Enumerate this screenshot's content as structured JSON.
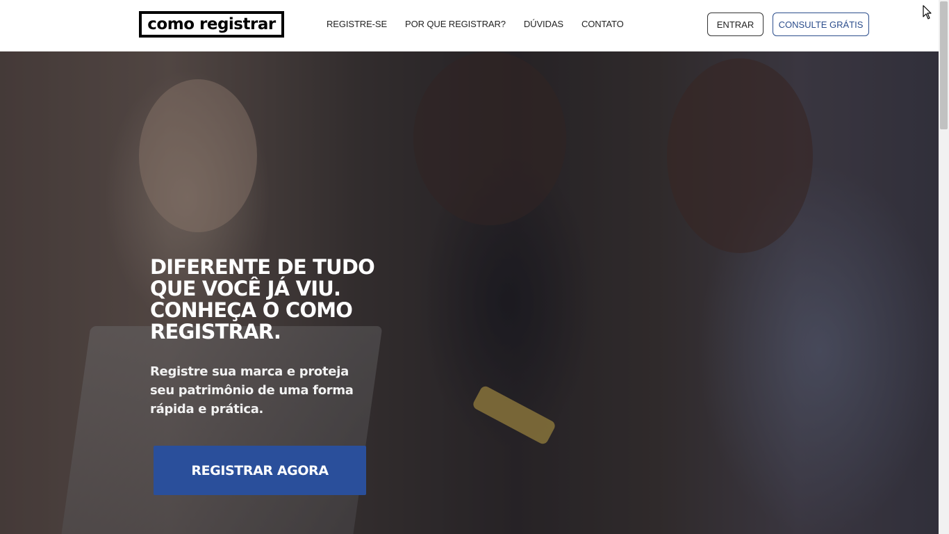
{
  "header": {
    "logo_text": "como registrar",
    "nav": [
      {
        "label": "REGISTRE-SE"
      },
      {
        "label": "POR QUE REGISTRAR?"
      },
      {
        "label": "DÚVIDAS"
      },
      {
        "label": "CONTATO"
      }
    ],
    "login_label": "ENTRAR",
    "consult_label": "CONSULTE GRÁTIS"
  },
  "hero": {
    "title": "DIFERENTE DE TUDO QUE VOCÊ JÁ VIU. CONHEÇA O COMO REGISTRAR.",
    "subtitle": "Registre sua marca e proteja seu patrimônio de uma forma rápida e prática.",
    "cta_label": "REGISTRAR AGORA"
  },
  "colors": {
    "accent": "#2a4f9b",
    "consult_border": "#2b4d8c"
  },
  "icons": {
    "cursor": "mouse-pointer-icon"
  }
}
